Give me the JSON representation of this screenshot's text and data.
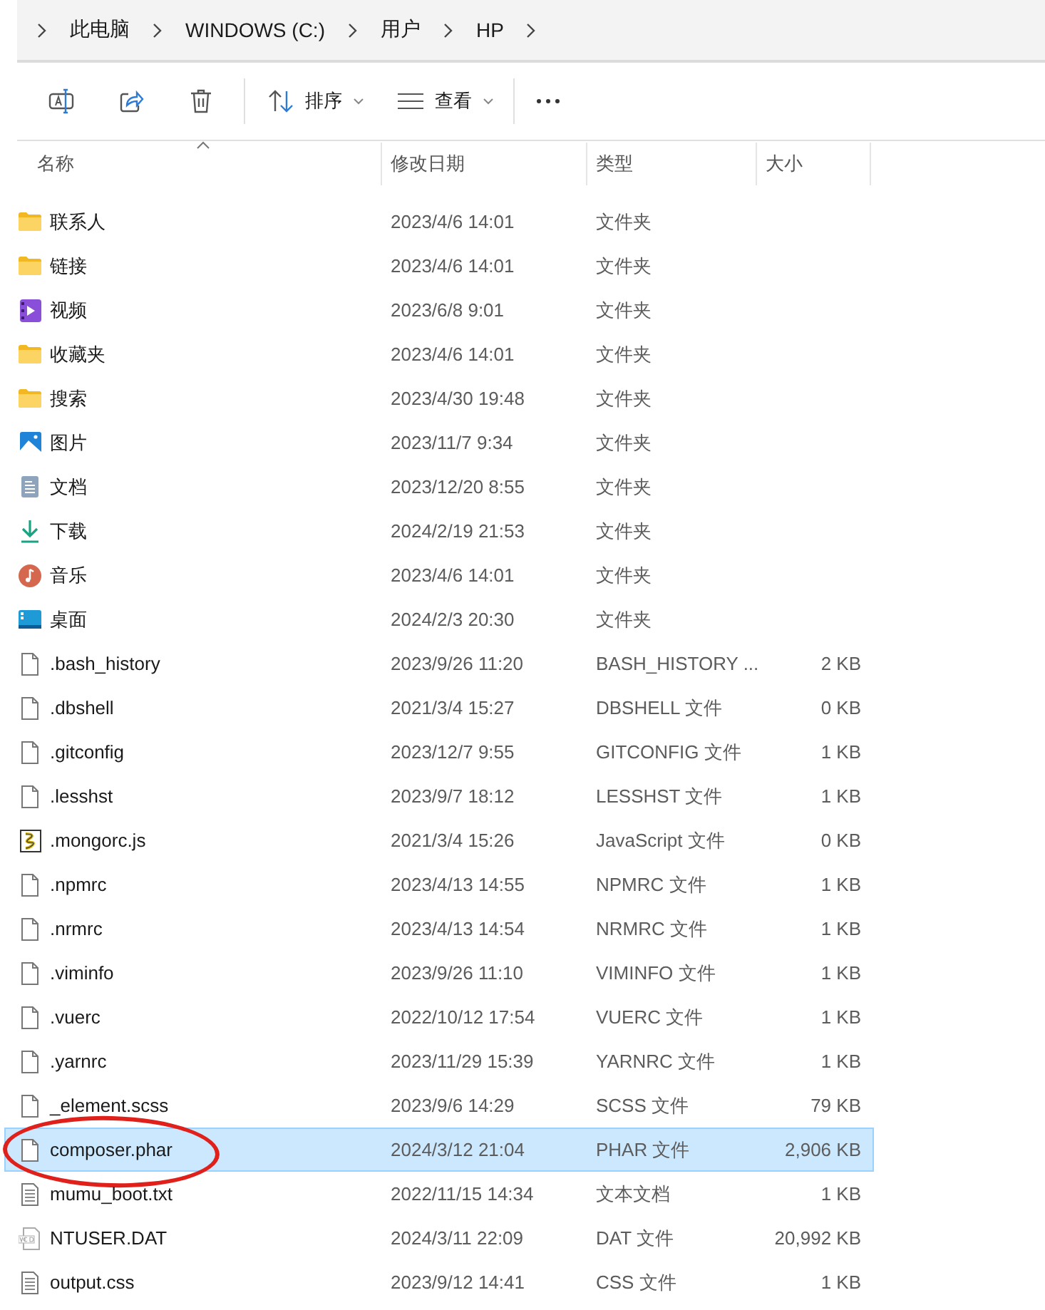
{
  "breadcrumb": [
    "此电脑",
    "WINDOWS (C:)",
    "用户",
    "HP"
  ],
  "toolbar": {
    "sort_label": "排序",
    "view_label": "查看"
  },
  "columns": [
    "名称",
    "修改日期",
    "类型",
    "大小"
  ],
  "rows": [
    {
      "kind": "folder",
      "name": "联系人",
      "date": "2023/4/6 14:01",
      "type": "文件夹",
      "selected": false,
      "circled": false
    },
    {
      "kind": "folder",
      "name": "链接",
      "date": "2023/4/6 14:01",
      "type": "文件夹",
      "selected": false,
      "circled": false
    },
    {
      "kind": "video",
      "name": "视频",
      "date": "2023/6/8 9:01",
      "type": "文件夹",
      "selected": false,
      "circled": false
    },
    {
      "kind": "folder",
      "name": "收藏夹",
      "date": "2023/4/6 14:01",
      "type": "文件夹",
      "selected": false,
      "circled": false
    },
    {
      "kind": "folder",
      "name": "搜索",
      "date": "2023/4/30 19:48",
      "type": "文件夹",
      "selected": false,
      "circled": false
    },
    {
      "kind": "pictures",
      "name": "图片",
      "date": "2023/11/7 9:34",
      "type": "文件夹",
      "selected": false,
      "circled": false
    },
    {
      "kind": "documents",
      "name": "文档",
      "date": "2023/12/20 8:55",
      "type": "文件夹",
      "selected": false,
      "circled": false
    },
    {
      "kind": "downloads",
      "name": "下载",
      "date": "2024/2/19 21:53",
      "type": "文件夹",
      "selected": false,
      "circled": false
    },
    {
      "kind": "music",
      "name": "音乐",
      "date": "2023/4/6 14:01",
      "type": "文件夹",
      "selected": false,
      "circled": false
    },
    {
      "kind": "desktop",
      "name": "桌面",
      "date": "2024/2/3 20:30",
      "type": "文件夹",
      "selected": false,
      "circled": false
    },
    {
      "kind": "file",
      "name": ".bash_history",
      "date": "2023/9/26 11:20",
      "type": "BASH_HISTORY ...",
      "size": "2 KB",
      "selected": false,
      "circled": false
    },
    {
      "kind": "file",
      "name": ".dbshell",
      "date": "2021/3/4 15:27",
      "type": "DBSHELL 文件",
      "size": "0 KB",
      "selected": false,
      "circled": false
    },
    {
      "kind": "file",
      "name": ".gitconfig",
      "date": "2023/12/7 9:55",
      "type": "GITCONFIG 文件",
      "size": "1 KB",
      "selected": false,
      "circled": false
    },
    {
      "kind": "file",
      "name": ".lesshst",
      "date": "2023/9/7 18:12",
      "type": "LESSHST 文件",
      "size": "1 KB",
      "selected": false,
      "circled": false
    },
    {
      "kind": "script",
      "name": ".mongorc.js",
      "date": "2021/3/4 15:26",
      "type": "JavaScript 文件",
      "size": "0 KB",
      "selected": false,
      "circled": false
    },
    {
      "kind": "file",
      "name": ".npmrc",
      "date": "2023/4/13 14:55",
      "type": "NPMRC 文件",
      "size": "1 KB",
      "selected": false,
      "circled": false
    },
    {
      "kind": "file",
      "name": ".nrmrc",
      "date": "2023/4/13 14:54",
      "type": "NRMRC 文件",
      "size": "1 KB",
      "selected": false,
      "circled": false
    },
    {
      "kind": "file",
      "name": ".viminfo",
      "date": "2023/9/26 11:10",
      "type": "VIMINFO 文件",
      "size": "1 KB",
      "selected": false,
      "circled": false
    },
    {
      "kind": "file",
      "name": ".vuerc",
      "date": "2022/10/12 17:54",
      "type": "VUERC 文件",
      "size": "1 KB",
      "selected": false,
      "circled": false
    },
    {
      "kind": "file",
      "name": ".yarnrc",
      "date": "2023/11/29 15:39",
      "type": "YARNRC 文件",
      "size": "1 KB",
      "selected": false,
      "circled": false
    },
    {
      "kind": "file",
      "name": "_element.scss",
      "date": "2023/9/6 14:29",
      "type": "SCSS 文件",
      "size": "79 KB",
      "selected": false,
      "circled": false
    },
    {
      "kind": "file",
      "name": "composer.phar",
      "date": "2024/3/12 21:04",
      "type": "PHAR 文件",
      "size": "2,906 KB",
      "selected": true,
      "circled": true
    },
    {
      "kind": "text",
      "name": "mumu_boot.txt",
      "date": "2022/11/15 14:34",
      "type": "文本文档",
      "size": "1 KB",
      "selected": false,
      "circled": false
    },
    {
      "kind": "data",
      "name": "NTUSER.DAT",
      "date": "2024/3/11 22:09",
      "type": "DAT 文件",
      "size": "20,992 KB",
      "selected": false,
      "circled": false
    },
    {
      "kind": "text",
      "name": "output.css",
      "date": "2023/9/12 14:41",
      "type": "CSS 文件",
      "size": "1 KB",
      "selected": false,
      "circled": false
    }
  ]
}
